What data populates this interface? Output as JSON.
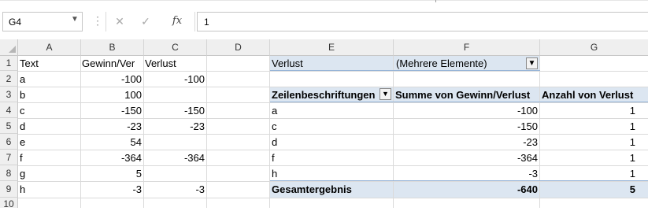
{
  "formula_bar": {
    "name_box": "G4",
    "dots": "⋮",
    "cancel_icon": "✕",
    "enter_icon": "✓",
    "fx_label": "fx",
    "formula_value": "1"
  },
  "columns": [
    "A",
    "B",
    "C",
    "D",
    "E",
    "F",
    "G"
  ],
  "rows": [
    "1",
    "2",
    "3",
    "4",
    "5",
    "6",
    "7",
    "8",
    "9",
    "10"
  ],
  "cells": {
    "A1": "Text",
    "B1": "Gewinn/Ver",
    "C1": "Verlust",
    "A2": "a",
    "B2": "-100",
    "C2": "-100",
    "A3": "b",
    "B3": "100",
    "A4": "c",
    "B4": "-150",
    "C4": "-150",
    "A5": "d",
    "B5": "-23",
    "C5": "-23",
    "A6": "e",
    "B6": "54",
    "A7": "f",
    "B7": "-364",
    "C7": "-364",
    "A8": "g",
    "B8": "5",
    "A9": "h",
    "B9": "-3",
    "C9": "-3"
  },
  "pivot": {
    "filter_field": "Verlust",
    "filter_value": "(Mehrere Elemente)",
    "headers": [
      "Zeilenbeschriftungen",
      "Summe von Gewinn/Verlust",
      "Anzahl von Verlust"
    ],
    "rows": [
      {
        "label": "a",
        "sum": "-100",
        "count": "1"
      },
      {
        "label": "c",
        "sum": "-150",
        "count": "1"
      },
      {
        "label": "d",
        "sum": "-23",
        "count": "1"
      },
      {
        "label": "f",
        "sum": "-364",
        "count": "1"
      },
      {
        "label": "h",
        "sum": "-3",
        "count": "1"
      }
    ],
    "total": {
      "label": "Gesamtergebnis",
      "sum": "-640",
      "count": "5"
    }
  }
}
